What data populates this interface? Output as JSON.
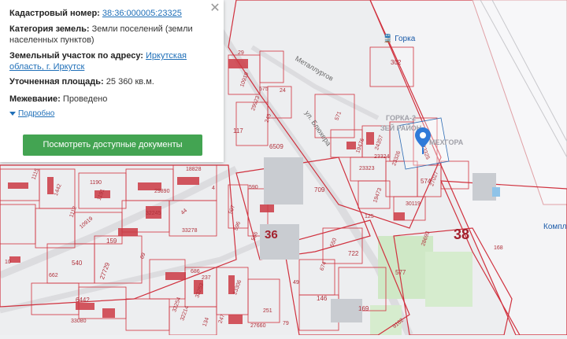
{
  "info_card": {
    "cadastral_label": "Кадастровый номер:",
    "cadastral_value": "38:36:000005:23325",
    "category_label": "Категория земель:",
    "category_value": "Земли поселений (земли населенных пунктов)",
    "address_label": "Земельный участок по адресу:",
    "address_value": "Иркутская область, г. Иркутск",
    "area_label": "Уточненная площадь:",
    "area_value": "25 360 кв.м.",
    "survey_label": "Межевание:",
    "survey_value": "Проведено",
    "more_link": "Подробно",
    "docs_button": "Посмотреть доступные документы",
    "close_icon": "close-icon"
  },
  "map": {
    "quarters": [
      "36",
      "38"
    ],
    "streets": [
      "ул. Блюхера",
      "Металлургов"
    ],
    "places": [
      "ГОРКА-2",
      "ЗЕЙ РАЙОН",
      "МЕХГОРА"
    ],
    "station": "Горка",
    "edge_text": "Компл",
    "plots": [
      "302",
      "575",
      "24",
      "29923",
      "249",
      "29",
      "10919",
      "117",
      "571",
      "6509",
      "19476",
      "24357",
      "23325",
      "23324",
      "23326",
      "23323",
      "19473",
      "574",
      "27027",
      "30119",
      "709",
      "18828",
      "1115",
      "1190",
      "1191",
      "4",
      "590",
      "29890",
      "32245",
      "44",
      "597",
      "1442",
      "1112",
      "10919",
      "33278",
      "596",
      "566",
      "159",
      "125",
      "28693",
      "550",
      "722",
      "168",
      "540",
      "27729",
      "686",
      "237",
      "577",
      "674",
      "69",
      "662",
      "10",
      "6442",
      "33253",
      "23306",
      "49",
      "146",
      "169",
      "251",
      "33080",
      "32214",
      "247",
      "27660",
      "79",
      "9162",
      "134",
      "33254"
    ],
    "pin_icon": "location-pin-icon",
    "colors": {
      "boundary": "#d0313e",
      "building": "#cc3a44",
      "road": "#d9d9d9",
      "green": "#cfe8c6"
    }
  }
}
